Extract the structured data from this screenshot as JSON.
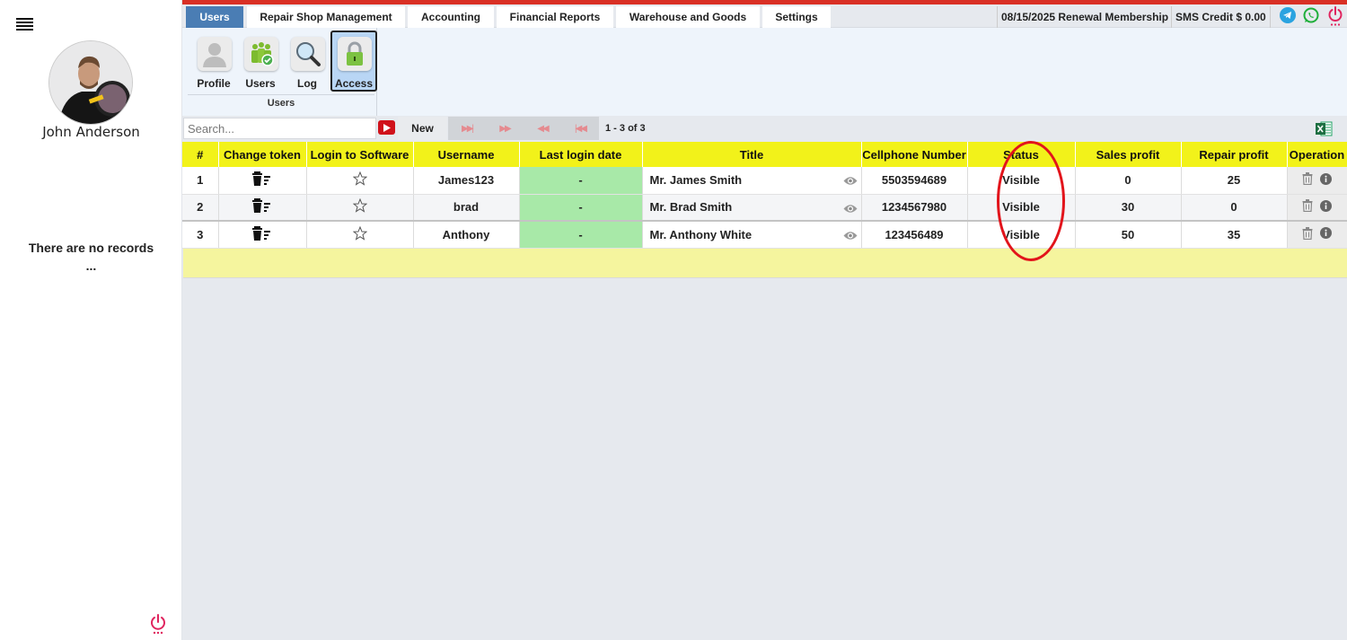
{
  "sidebar": {
    "user_name": "John Anderson",
    "empty_message": "There are no records",
    "empty_dots": "..."
  },
  "tabs": [
    {
      "label": "Users",
      "active": true
    },
    {
      "label": "Repair Shop Management"
    },
    {
      "label": "Accounting"
    },
    {
      "label": "Financial Reports"
    },
    {
      "label": "Warehouse and Goods"
    },
    {
      "label": "Settings"
    }
  ],
  "header": {
    "renewal": "08/15/2025 Renewal Membership",
    "sms_credit": "SMS Credit $ 0.00"
  },
  "ribbon": {
    "buttons": [
      {
        "label": "Profile"
      },
      {
        "label": "Users"
      },
      {
        "label": "Log"
      },
      {
        "label": "Access",
        "active": true
      }
    ],
    "group_label": "Users"
  },
  "toolbar": {
    "search_placeholder": "Search...",
    "new_label": "New",
    "page_info": "1 - 3 of 3"
  },
  "table": {
    "columns": [
      "#",
      "Change token",
      "Login to Software",
      "Username",
      "Last login date",
      "Title",
      "Cellphone Number",
      "Status",
      "Sales profit",
      "Repair profit",
      "Operation"
    ],
    "rows": [
      {
        "num": "1",
        "username": "James123",
        "last_login": "-",
        "title": "Mr. James Smith",
        "cellphone": "5503594689",
        "status": "Visible",
        "sales_profit": "0",
        "repair_profit": "25"
      },
      {
        "num": "2",
        "username": "brad",
        "last_login": "-",
        "title": "Mr. Brad Smith",
        "cellphone": "1234567980",
        "status": "Visible",
        "sales_profit": "30",
        "repair_profit": "0"
      },
      {
        "num": "3",
        "username": "Anthony",
        "last_login": "-",
        "title": "Mr. Anthony White",
        "cellphone": "123456489",
        "status": "Visible",
        "sales_profit": "50",
        "repair_profit": "35"
      }
    ]
  },
  "colors": {
    "accent_red": "#d93025",
    "tab_active": "#4a7db4",
    "header_yellow": "#f2f21a",
    "login_green": "#a8e9a8"
  }
}
